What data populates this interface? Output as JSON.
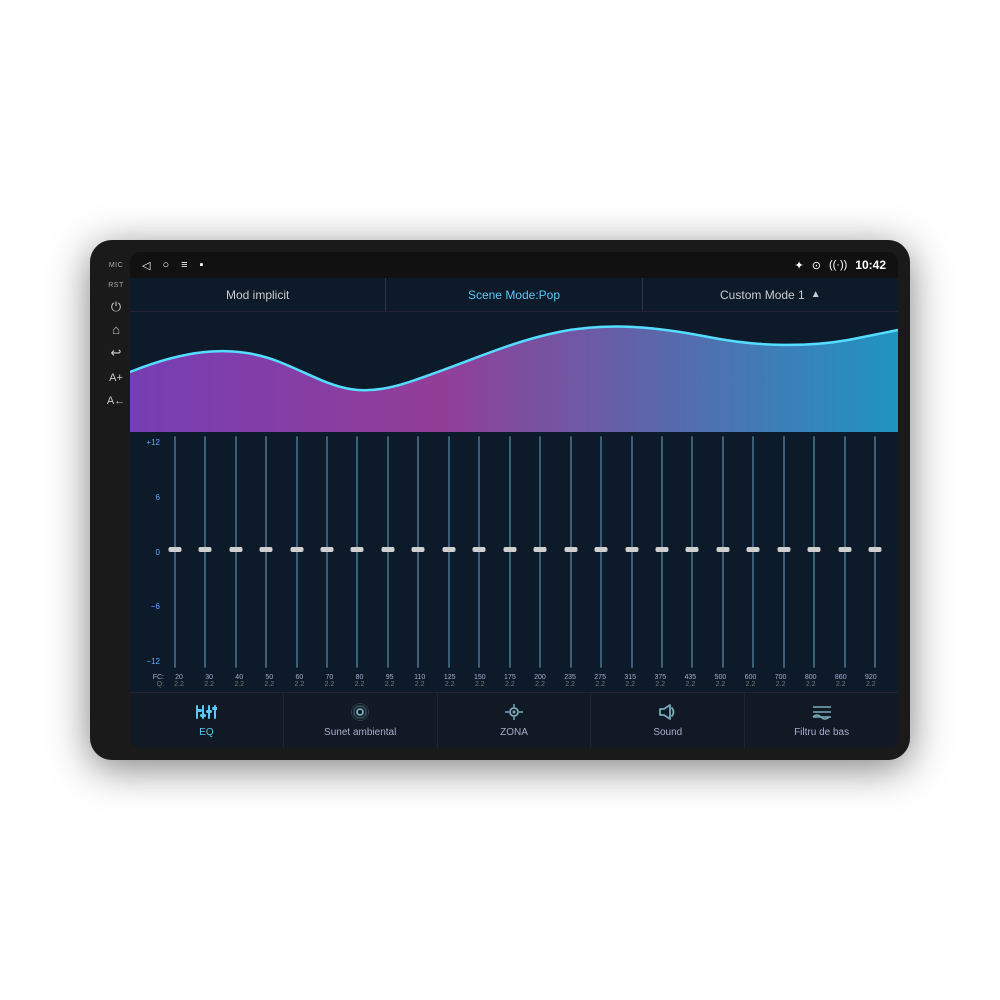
{
  "device": {
    "status_bar": {
      "time": "10:42",
      "icons": [
        "bluetooth",
        "location",
        "wifi"
      ]
    },
    "side_buttons": [
      {
        "label": "MIC",
        "icon": ""
      },
      {
        "label": "RST",
        "icon": "⏻"
      },
      {
        "label": "",
        "icon": "⌂"
      },
      {
        "label": "",
        "icon": "↩"
      },
      {
        "label": "A+",
        "icon": ""
      },
      {
        "label": "A←",
        "icon": ""
      }
    ],
    "nav_buttons": [
      "◁",
      "○",
      "≡",
      "■"
    ],
    "header_tabs": [
      {
        "label": "Mod implicit",
        "active": false
      },
      {
        "label": "Scene Mode:Pop",
        "active": true
      },
      {
        "label": "Custom Mode 1",
        "active": false,
        "arrow": "▲"
      }
    ],
    "eq_scale": [
      "+12",
      "6",
      "0",
      "−6",
      "−12"
    ],
    "frequencies": [
      {
        "fc": "20",
        "q": "2.2",
        "thumb_pct": 50
      },
      {
        "fc": "30",
        "q": "2.2",
        "thumb_pct": 50
      },
      {
        "fc": "40",
        "q": "2.2",
        "thumb_pct": 50
      },
      {
        "fc": "50",
        "q": "2.2",
        "thumb_pct": 50
      },
      {
        "fc": "60",
        "q": "2.2",
        "thumb_pct": 50
      },
      {
        "fc": "70",
        "q": "2.2",
        "thumb_pct": 50
      },
      {
        "fc": "80",
        "q": "2.2",
        "thumb_pct": 50
      },
      {
        "fc": "95",
        "q": "2.2",
        "thumb_pct": 50
      },
      {
        "fc": "110",
        "q": "2.2",
        "thumb_pct": 50
      },
      {
        "fc": "125",
        "q": "2.2",
        "thumb_pct": 50
      },
      {
        "fc": "150",
        "q": "2.2",
        "thumb_pct": 50
      },
      {
        "fc": "175",
        "q": "2.2",
        "thumb_pct": 50
      },
      {
        "fc": "200",
        "q": "2.2",
        "thumb_pct": 50
      },
      {
        "fc": "235",
        "q": "2.2",
        "thumb_pct": 50
      },
      {
        "fc": "275",
        "q": "2.2",
        "thumb_pct": 50
      },
      {
        "fc": "315",
        "q": "2.2",
        "thumb_pct": 50
      },
      {
        "fc": "375",
        "q": "2.2",
        "thumb_pct": 50
      },
      {
        "fc": "435",
        "q": "2.2",
        "thumb_pct": 50
      },
      {
        "fc": "500",
        "q": "2.2",
        "thumb_pct": 50
      },
      {
        "fc": "600",
        "q": "2.2",
        "thumb_pct": 50
      },
      {
        "fc": "700",
        "q": "2.2",
        "thumb_pct": 50
      },
      {
        "fc": "800",
        "q": "2.2",
        "thumb_pct": 50
      },
      {
        "fc": "860",
        "q": "2.2",
        "thumb_pct": 50
      },
      {
        "fc": "920",
        "q": "2.2",
        "thumb_pct": 50
      }
    ],
    "bottom_nav": [
      {
        "id": "eq",
        "label": "EQ",
        "icon": "⚙",
        "active": true
      },
      {
        "id": "ambient",
        "label": "Sunet ambiental",
        "icon": "◎",
        "active": false
      },
      {
        "id": "zone",
        "label": "ZONA",
        "icon": "◎",
        "active": false
      },
      {
        "id": "sound",
        "label": "Sound",
        "icon": "🔊",
        "active": false
      },
      {
        "id": "filter",
        "label": "Filtru de bas",
        "icon": "≡",
        "active": false
      }
    ]
  }
}
